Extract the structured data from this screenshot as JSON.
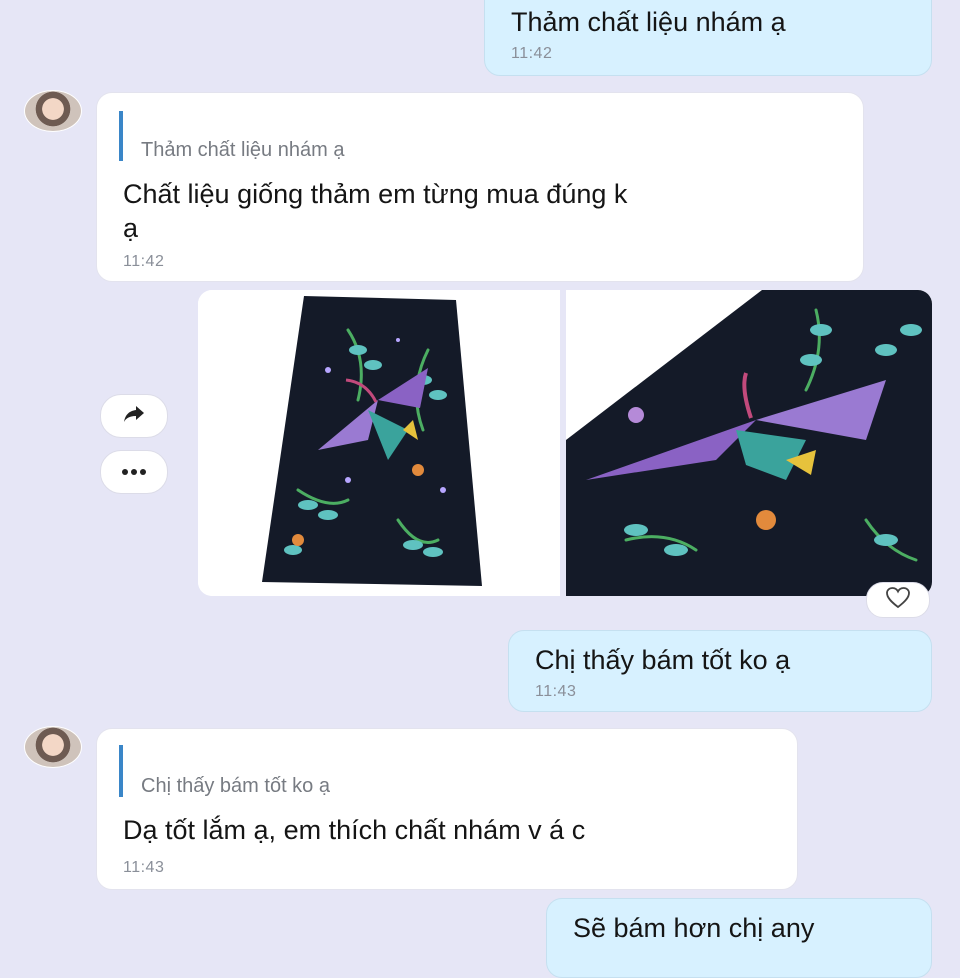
{
  "messages": [
    {
      "id": "m1",
      "direction": "out",
      "text": "Thảm chất liệu nhám ạ",
      "time": "11:42"
    },
    {
      "id": "m2",
      "direction": "in",
      "quote": "Thảm chất liệu nhám ạ",
      "text_line1": "Chất liệu giống thảm em từng mua đúng k",
      "text_line2": "ạ",
      "time": "11:42"
    },
    {
      "id": "m3",
      "direction": "out",
      "text": "Chị thấy bám tốt ko ạ",
      "time": "11:43"
    },
    {
      "id": "m4",
      "direction": "in",
      "quote": "Chị thấy bám tốt ko ạ",
      "text": "Dạ tốt lắm ạ, em thích chất nhám v á c",
      "time": "11:43"
    },
    {
      "id": "m5",
      "direction": "out",
      "text": "Sẽ bám hơn chị any"
    }
  ],
  "image_message": {
    "images": [
      "runner-rug-photo",
      "rug-closeup-photo"
    ],
    "actions": {
      "forward_icon": "share-arrow-icon",
      "more_icon": "more-dots-icon",
      "react_icon": "heart-icon"
    }
  },
  "colors": {
    "background": "#e6e6f6",
    "outgoing_bubble": "#d7f1ff",
    "incoming_bubble": "#ffffff",
    "quote_bar": "#3a86c8",
    "rug_background": "#141a28"
  }
}
